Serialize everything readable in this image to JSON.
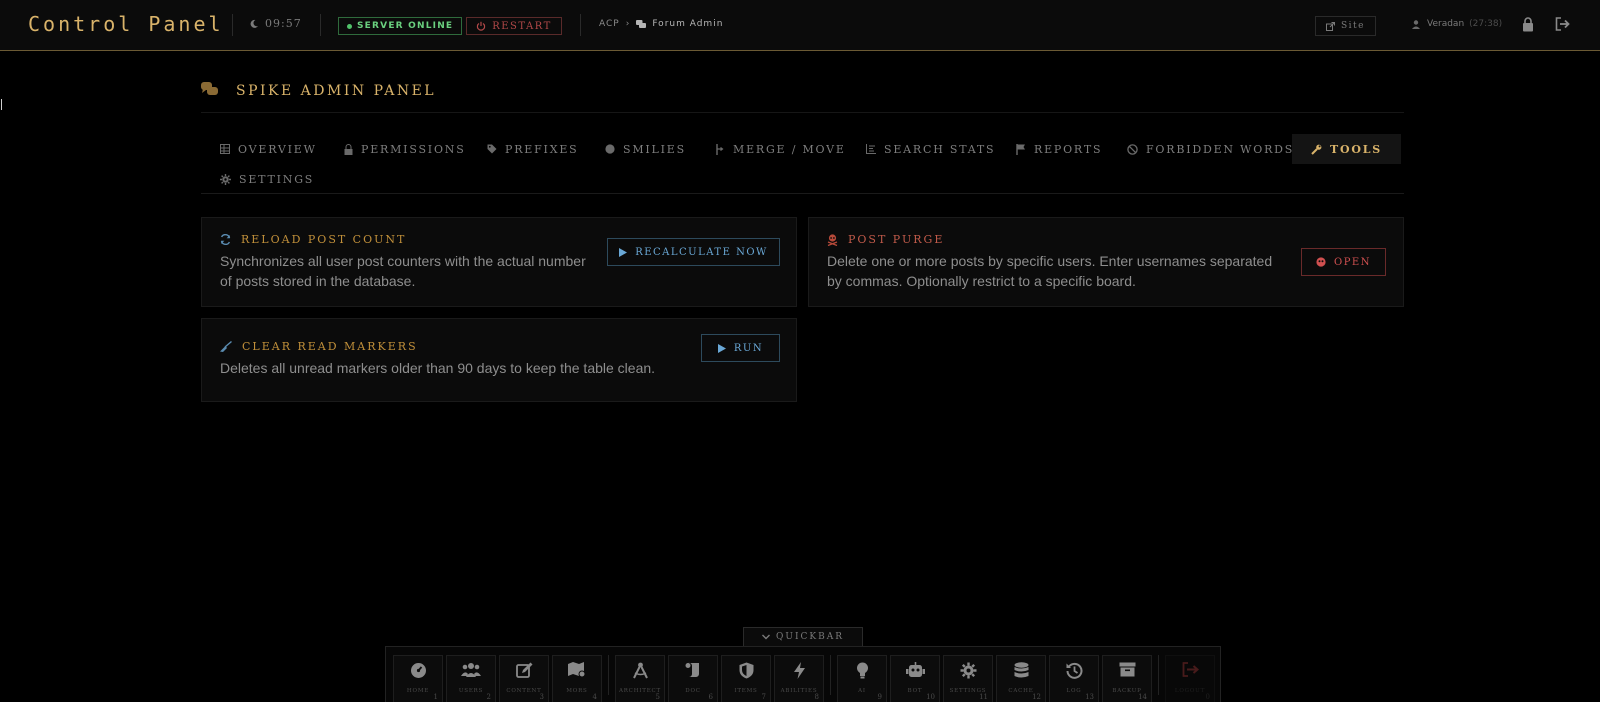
{
  "header": {
    "brand": "Control Panel",
    "clock": "09:57",
    "server_status": "SERVER ONLINE",
    "restart_label": "RESTART",
    "breadcrumb": {
      "root": "ACP",
      "separator": "›",
      "current": "Forum Admin"
    },
    "site_label": "Site",
    "username": "Veradan",
    "session_time": "(27:38)"
  },
  "page": {
    "title": "SPIKE ADMIN PANEL"
  },
  "tabs": [
    {
      "label": "OVERVIEW",
      "icon": "table-icon"
    },
    {
      "label": "PERMISSIONS",
      "icon": "lock-icon"
    },
    {
      "label": "PREFIXES",
      "icon": "tag-icon"
    },
    {
      "label": "SMILIES",
      "icon": "smile-icon"
    },
    {
      "label": "MERGE / MOVE",
      "icon": "merge-icon"
    },
    {
      "label": "SEARCH STATS",
      "icon": "chart-icon"
    },
    {
      "label": "REPORTS",
      "icon": "flag-icon"
    },
    {
      "label": "FORBIDDEN WORDS",
      "icon": "ban-icon"
    },
    {
      "label": "TOOLS",
      "icon": "wrench-icon",
      "active": true
    },
    {
      "label": "SETTINGS",
      "icon": "gear-icon"
    }
  ],
  "tools": {
    "reload": {
      "title": "RELOAD POST COUNT",
      "description": "Synchronizes all user post counters with the actual number of posts stored in the database.",
      "button": "RECALCULATE NOW"
    },
    "purge": {
      "title": "POST PURGE",
      "description": "Delete one or more posts by specific users. Enter usernames separated by commas. Optionally restrict to a specific board.",
      "button": "OPEN"
    },
    "markers": {
      "title": "CLEAR READ MARKERS",
      "description": "Deletes all unread markers older than 90 days to keep the table clean.",
      "button": "RUN"
    }
  },
  "quickbar": {
    "toggle_label": "QUICKBAR",
    "items": [
      {
        "label": "HOME",
        "key": "1",
        "icon": "dashboard-icon"
      },
      {
        "label": "USERS",
        "key": "2",
        "icon": "users-icon"
      },
      {
        "label": "CONTENT",
        "key": "3",
        "icon": "edit-icon"
      },
      {
        "label": "MORS",
        "key": "4",
        "icon": "map-icon"
      },
      {
        "label": "ARCHITECT",
        "key": "5",
        "icon": "compass-icon"
      },
      {
        "label": "DOC",
        "key": "6",
        "icon": "scroll-icon"
      },
      {
        "label": "ITEMS",
        "key": "7",
        "icon": "shield-icon"
      },
      {
        "label": "ABILITIES",
        "key": "8",
        "icon": "bolt-icon"
      },
      {
        "label": "AI",
        "key": "9",
        "icon": "bulb-icon"
      },
      {
        "label": "BOT",
        "key": "10",
        "icon": "robot-icon"
      },
      {
        "label": "SETTINGS",
        "key": "11",
        "icon": "gear-icon"
      },
      {
        "label": "CACHE",
        "key": "12",
        "icon": "database-icon"
      },
      {
        "label": "LOG",
        "key": "13",
        "icon": "history-icon"
      },
      {
        "label": "BACKUP",
        "key": "14",
        "icon": "archive-icon"
      },
      {
        "label": "LOGOUT",
        "key": "0",
        "icon": "logout-icon"
      }
    ]
  },
  "colors": {
    "gold": "#d9b36a",
    "blue": "#6aa8d6",
    "red": "#d05050",
    "green": "#6ad07f"
  }
}
